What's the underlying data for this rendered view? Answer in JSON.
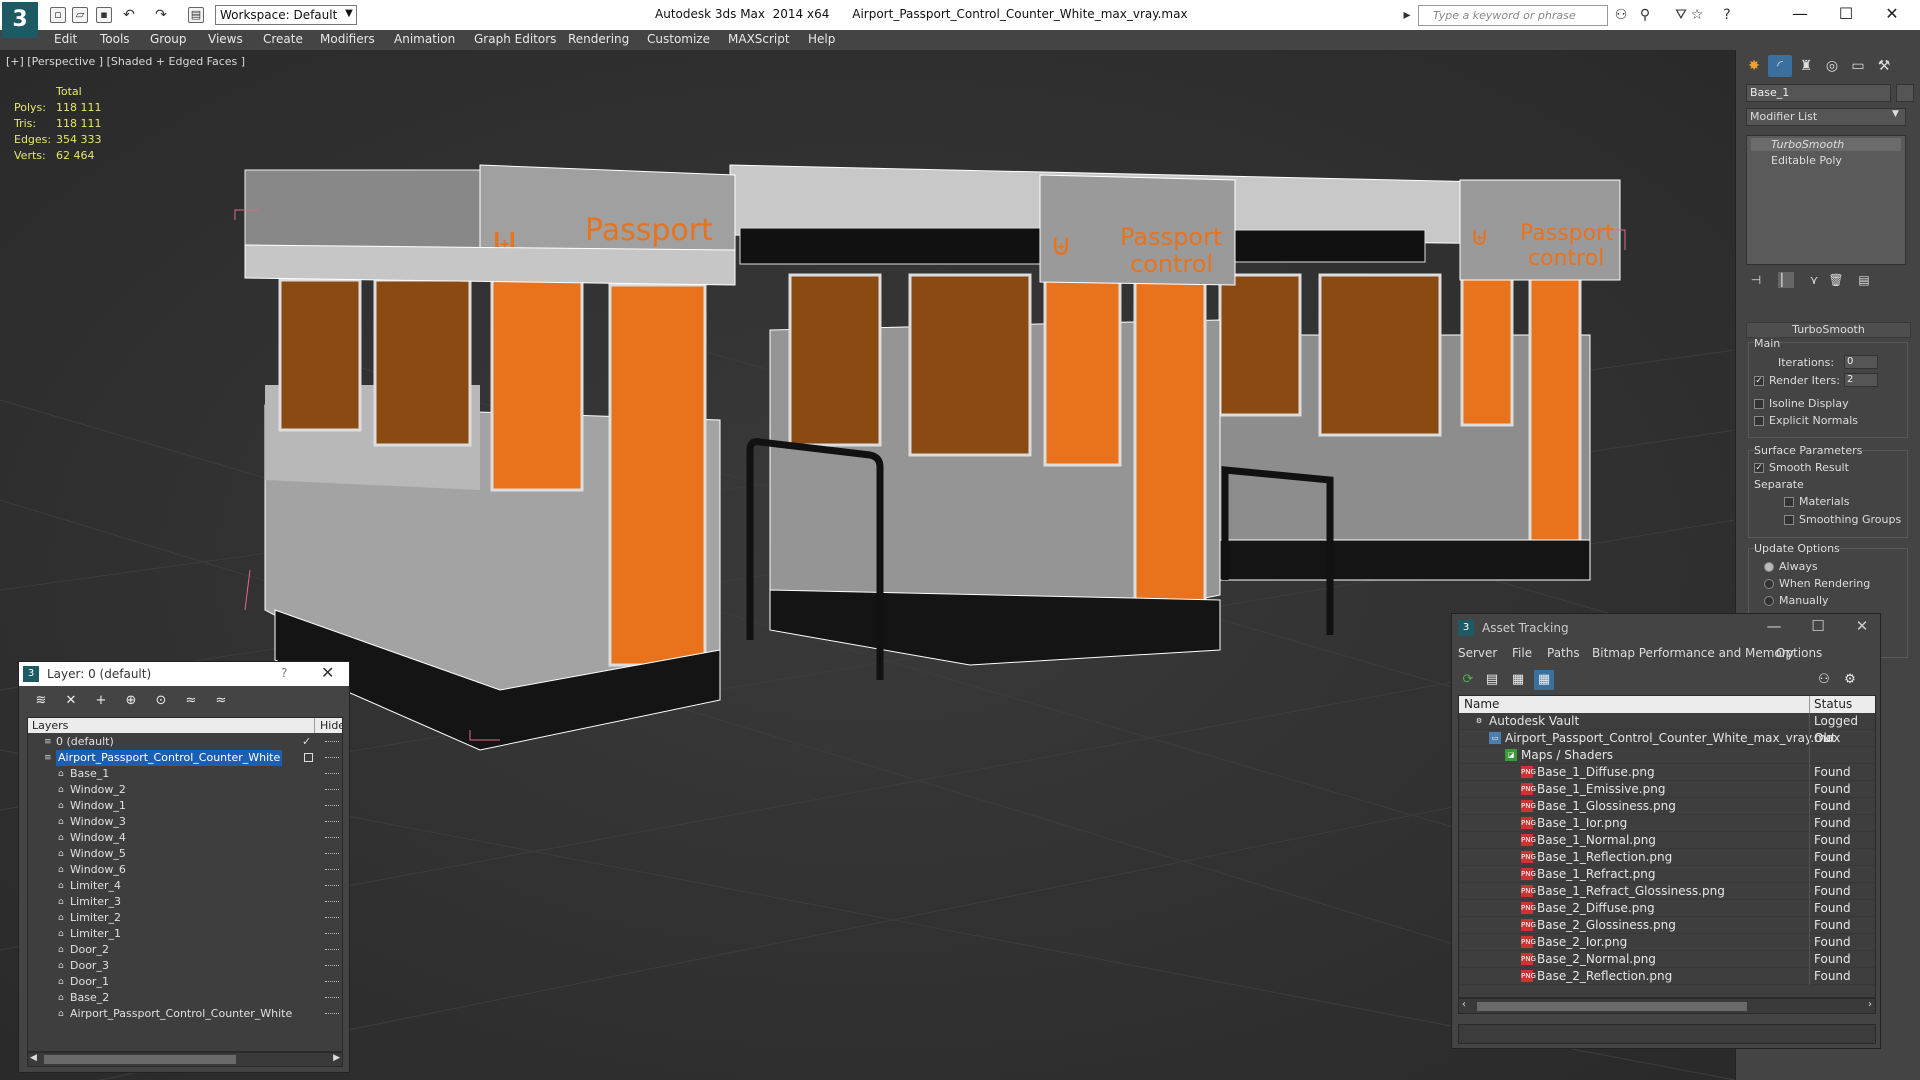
{
  "titlebar": {
    "app_logo": "3",
    "workspace": "Workspace: Default",
    "title": "Autodesk 3ds Max  2014 x64      Airport_Passport_Control_Counter_White_max_vray.max",
    "search_placeholder": "Type a keyword or phrase",
    "minimize": "—",
    "maximize": "☐",
    "close": "✕"
  },
  "menu": [
    "Edit",
    "Tools",
    "Group",
    "Views",
    "Create",
    "Modifiers",
    "Animation",
    "Graph Editors",
    "Rendering",
    "Customize",
    "MAXScript",
    "Help"
  ],
  "viewport": {
    "label": "[+] [Perspective ] [Shaded + Edged Faces ]",
    "stats_header": "Total",
    "stats": [
      {
        "label": "Polys:",
        "value": "118 111"
      },
      {
        "label": "Tris:",
        "value": "118 111"
      },
      {
        "label": "Edges:",
        "value": "354 333"
      },
      {
        "label": "Verts:",
        "value": "62 464"
      }
    ],
    "sign_text_1": "Passport",
    "sign_text_2": "control"
  },
  "command_panel": {
    "object_name": "Base_1",
    "modifier_list": "Modifier List",
    "stack": [
      "TurboSmooth",
      "Editable Poly"
    ],
    "turbosmooth_title": "TurboSmooth",
    "main_label": "Main",
    "iterations_label": "Iterations:",
    "iterations_value": "0",
    "render_iters_label": "Render Iters:",
    "render_iters_value": "2",
    "isoline": "Isoline Display",
    "explicit_normals": "Explicit Normals",
    "surface_params": "Surface Parameters",
    "smooth_result": "Smooth Result",
    "separate": "Separate",
    "materials": "Materials",
    "smoothing_groups": "Smoothing Groups",
    "update_options": "Update Options",
    "always": "Always",
    "when_rendering": "When Rendering",
    "manually": "Manually"
  },
  "layer_window": {
    "title": "Layer: 0 (default)",
    "help": "?",
    "close": "✕",
    "col_layers": "Layers",
    "col_hide": "Hide",
    "rows": [
      {
        "name": "0 (default)",
        "level": 0,
        "type": "layer",
        "check": "✓"
      },
      {
        "name": "Airport_Passport_Control_Counter_White",
        "level": 0,
        "type": "layer",
        "selected": true
      },
      {
        "name": "Base_1",
        "level": 1,
        "type": "object"
      },
      {
        "name": "Window_2",
        "level": 1,
        "type": "object"
      },
      {
        "name": "Window_1",
        "level": 1,
        "type": "object"
      },
      {
        "name": "Window_3",
        "level": 1,
        "type": "object"
      },
      {
        "name": "Window_4",
        "level": 1,
        "type": "object"
      },
      {
        "name": "Window_5",
        "level": 1,
        "type": "object"
      },
      {
        "name": "Window_6",
        "level": 1,
        "type": "object"
      },
      {
        "name": "Limiter_4",
        "level": 1,
        "type": "object"
      },
      {
        "name": "Limiter_3",
        "level": 1,
        "type": "object"
      },
      {
        "name": "Limiter_2",
        "level": 1,
        "type": "object"
      },
      {
        "name": "Limiter_1",
        "level": 1,
        "type": "object"
      },
      {
        "name": "Door_2",
        "level": 1,
        "type": "object"
      },
      {
        "name": "Door_3",
        "level": 1,
        "type": "object"
      },
      {
        "name": "Door_1",
        "level": 1,
        "type": "object"
      },
      {
        "name": "Base_2",
        "level": 1,
        "type": "object"
      },
      {
        "name": "Airport_Passport_Control_Counter_White",
        "level": 1,
        "type": "object"
      }
    ]
  },
  "asset_window": {
    "title": "Asset Tracking",
    "menu": [
      "Server",
      "File",
      "Paths",
      "Bitmap Performance and Memory",
      "Options"
    ],
    "col_name": "Name",
    "col_status": "Status",
    "rows": [
      {
        "name": "Autodesk Vault",
        "status": "Logged Out",
        "level": 0,
        "icon": "vault"
      },
      {
        "name": "Airport_Passport_Control_Counter_White_max_vray.max",
        "status": "Ok",
        "level": 1,
        "icon": "max"
      },
      {
        "name": "Maps / Shaders",
        "status": "",
        "level": 2,
        "icon": "maps"
      },
      {
        "name": "Base_1_Diffuse.png",
        "status": "Found",
        "level": 3,
        "icon": "png"
      },
      {
        "name": "Base_1_Emissive.png",
        "status": "Found",
        "level": 3,
        "icon": "png"
      },
      {
        "name": "Base_1_Glossiness.png",
        "status": "Found",
        "level": 3,
        "icon": "png"
      },
      {
        "name": "Base_1_Ior.png",
        "status": "Found",
        "level": 3,
        "icon": "png"
      },
      {
        "name": "Base_1_Normal.png",
        "status": "Found",
        "level": 3,
        "icon": "png"
      },
      {
        "name": "Base_1_Reflection.png",
        "status": "Found",
        "level": 3,
        "icon": "png"
      },
      {
        "name": "Base_1_Refract.png",
        "status": "Found",
        "level": 3,
        "icon": "png"
      },
      {
        "name": "Base_1_Refract_Glossiness.png",
        "status": "Found",
        "level": 3,
        "icon": "png"
      },
      {
        "name": "Base_2_Diffuse.png",
        "status": "Found",
        "level": 3,
        "icon": "png"
      },
      {
        "name": "Base_2_Glossiness.png",
        "status": "Found",
        "level": 3,
        "icon": "png"
      },
      {
        "name": "Base_2_Ior.png",
        "status": "Found",
        "level": 3,
        "icon": "png"
      },
      {
        "name": "Base_2_Normal.png",
        "status": "Found",
        "level": 3,
        "icon": "png"
      },
      {
        "name": "Base_2_Reflection.png",
        "status": "Found",
        "level": 3,
        "icon": "png"
      }
    ]
  },
  "colors": {
    "accent_orange": "#e8731c",
    "selection_blue": "#1a5fb4",
    "stats_yellow": "#e6e66e"
  }
}
